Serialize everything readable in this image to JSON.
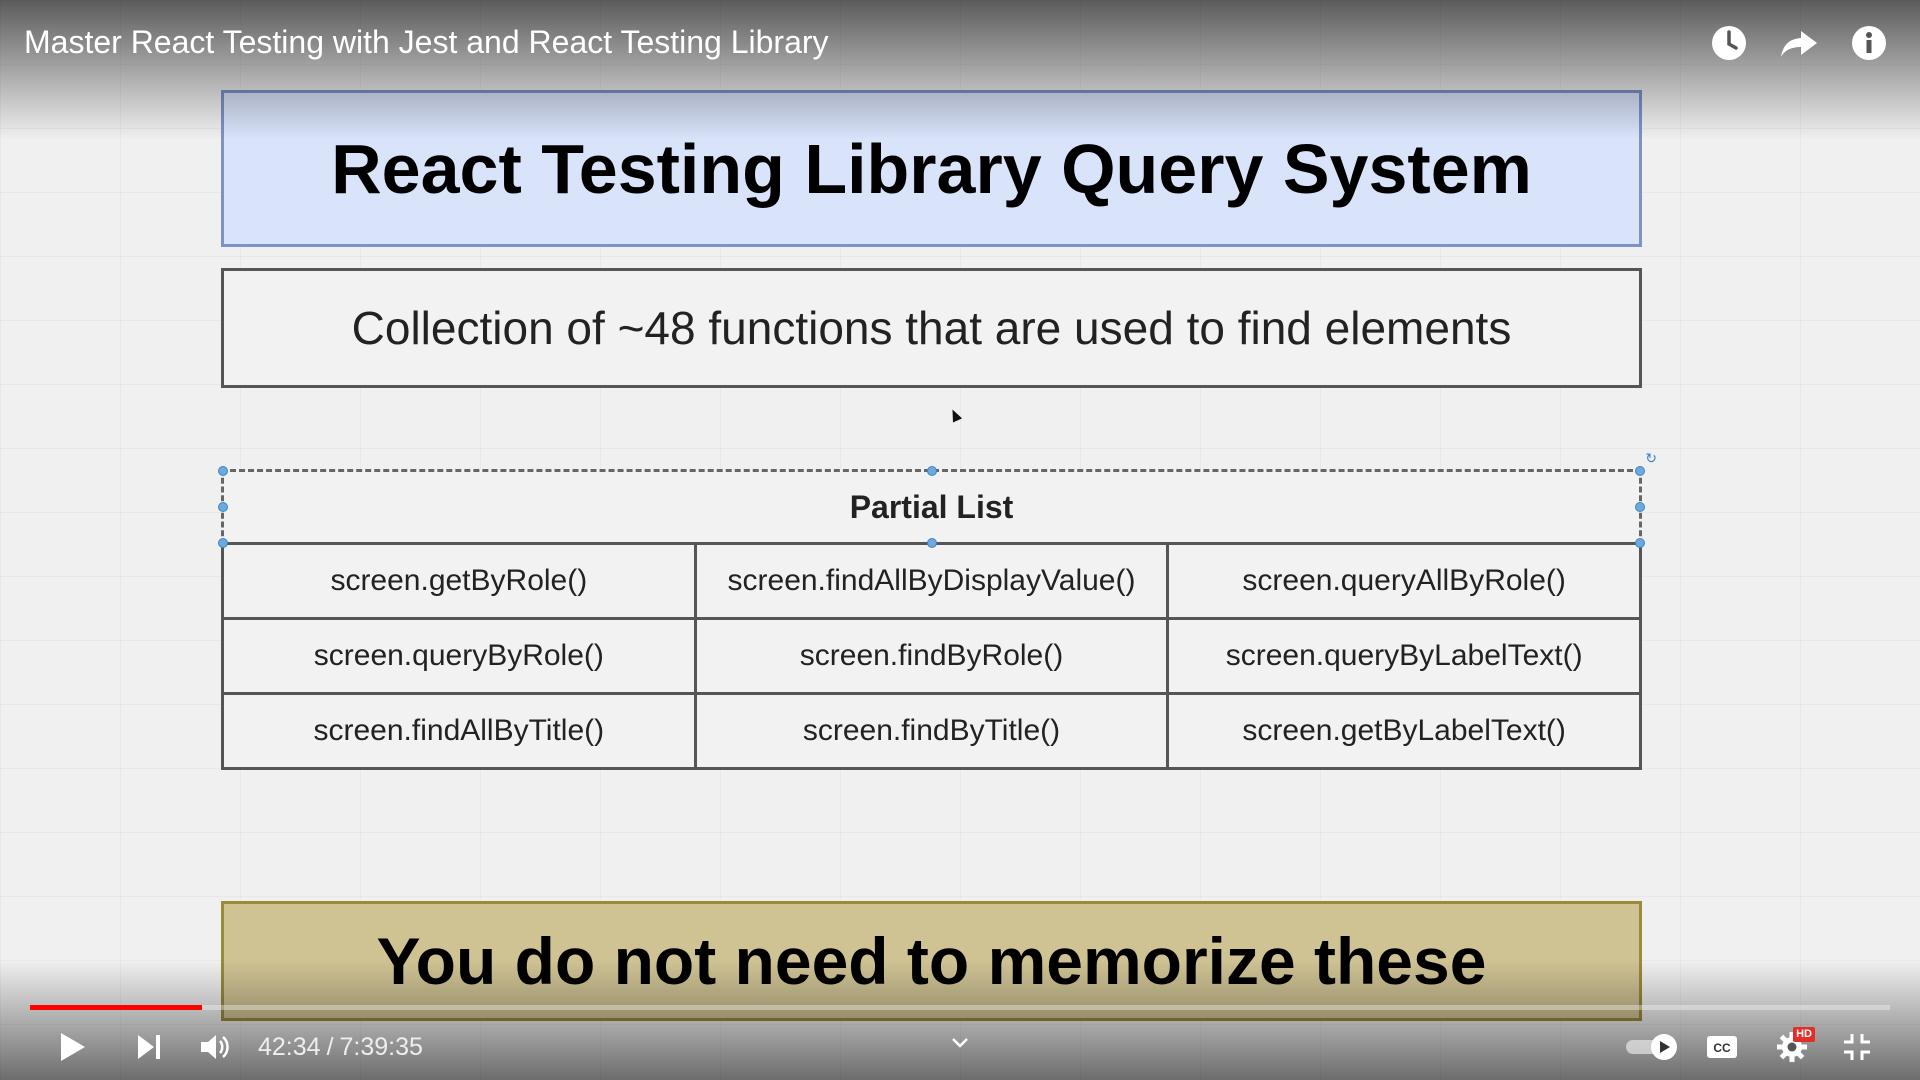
{
  "video": {
    "title": "Master React Testing with Jest and React Testing Library"
  },
  "slide": {
    "title": "React Testing Library Query System",
    "description": "Collection of ~48 functions that are used to find elements",
    "table": {
      "header": "Partial List",
      "rows": [
        [
          "screen.getByRole()",
          "screen.findAllByDisplayValue()",
          "screen.queryAllByRole()"
        ],
        [
          "screen.queryByRole()",
          "screen.findByRole()",
          "screen.queryByLabelText()"
        ],
        [
          "screen.findAllByTitle()",
          "screen.findByTitle()",
          "screen.getByLabelText()"
        ]
      ]
    },
    "footer": "You do not need to memorize these",
    "colors": {
      "title_bg": "#d9e3fa",
      "footer_bg": "#cfc394"
    }
  },
  "top_bar": {
    "icons": [
      "watch-later-icon",
      "share-icon",
      "info-icon"
    ]
  },
  "player": {
    "current_time": "42:34",
    "separator": "/",
    "duration": "7:39:35",
    "progress_fraction": 0.0924,
    "accent_color": "#ff0000",
    "hd_badge": "HD",
    "icons": [
      "play-icon",
      "next-icon",
      "volume-icon",
      "chevron-down-icon",
      "autoplay-toggle-icon",
      "captions-icon",
      "settings-icon",
      "exit-fullscreen-icon"
    ]
  }
}
